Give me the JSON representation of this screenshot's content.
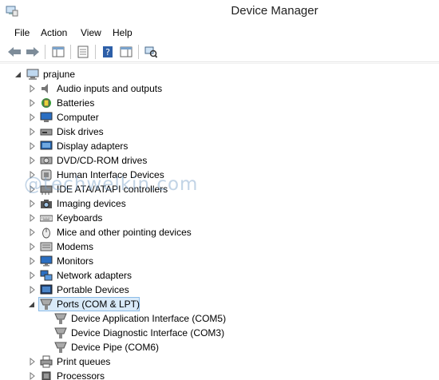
{
  "window": {
    "title": "Device Manager"
  },
  "menu": {
    "items": [
      "File",
      "Action",
      "View",
      "Help"
    ]
  },
  "watermark": "@techwelkin.com",
  "tree": {
    "root": "prajune",
    "categories": [
      "Audio inputs and outputs",
      "Batteries",
      "Computer",
      "Disk drives",
      "Display adapters",
      "DVD/CD-ROM drives",
      "Human Interface Devices",
      "IDE ATA/ATAPI controllers",
      "Imaging devices",
      "Keyboards",
      "Mice and other pointing devices",
      "Modems",
      "Monitors",
      "Network adapters",
      "Portable Devices",
      "Ports (COM & LPT)",
      "Print queues",
      "Processors"
    ],
    "ports_children": [
      "Device Application Interface (COM5)",
      "Device Diagnostic Interface (COM3)",
      "Device Pipe (COM6)"
    ]
  }
}
